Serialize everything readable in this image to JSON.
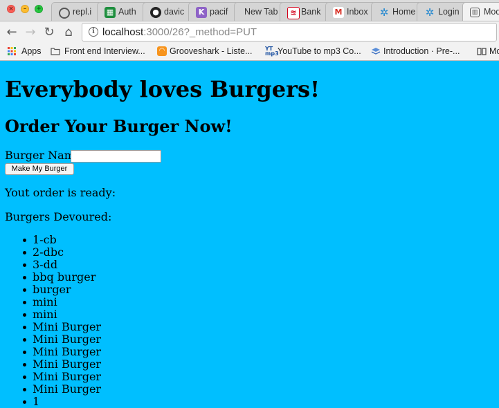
{
  "browser": {
    "tabs": [
      {
        "label": "repl.i",
        "icon": "repl-icon",
        "color": "#555555"
      },
      {
        "label": "Auth",
        "icon": "sheets-icon",
        "color": "#1e8e3e"
      },
      {
        "label": "davic",
        "icon": "github-icon",
        "color": "#222222"
      },
      {
        "label": "pacif",
        "icon": "k-icon",
        "color": "#8e63c7"
      },
      {
        "label": "New Tab",
        "icon": "",
        "color": ""
      },
      {
        "label": "Bank",
        "icon": "bank-icon",
        "color": "#d4001a"
      },
      {
        "label": "Inbox",
        "icon": "gmail-icon",
        "color": "#d93025"
      },
      {
        "label": "Home",
        "icon": "gear-icon",
        "color": "#2a8bd0"
      },
      {
        "label": "Login",
        "icon": "gear-icon",
        "color": "#2a8bd0"
      },
      {
        "label": "Mod",
        "icon": "book-icon",
        "color": "#555555"
      }
    ],
    "url_host": "localhost",
    "url_path": ":3000/26?_method=PUT",
    "bookmarks": [
      {
        "label": "Apps",
        "icon": "apps-grid-icon"
      },
      {
        "label": "Front end Interview...",
        "icon": "folder-icon"
      },
      {
        "label": "Grooveshark - Liste...",
        "icon": "grooveshark-icon"
      },
      {
        "label": "YouTube to mp3 Co...",
        "icon": "yt-mp3-icon"
      },
      {
        "label": "Introduction · Pre-...",
        "icon": "layers-icon"
      },
      {
        "label": "Mo",
        "icon": "book-icon"
      }
    ]
  },
  "page": {
    "title": "Everybody loves Burgers!",
    "order_title": "Order Your Burger Now!",
    "burger_name_label": "Burger Name:",
    "burger_name_value": "",
    "make_button": "Make My Burger",
    "order_status": "Yout order is ready:",
    "devoured_label": "Burgers Devoured:",
    "devoured": [
      "1-cb",
      "2-dbc",
      "3-dd",
      "bbq burger",
      "burger",
      "mini",
      "mini",
      "Mini Burger",
      "Mini Burger",
      "Mini Burger",
      "Mini Burger",
      "Mini Burger",
      "Mini Burger",
      "1"
    ]
  }
}
